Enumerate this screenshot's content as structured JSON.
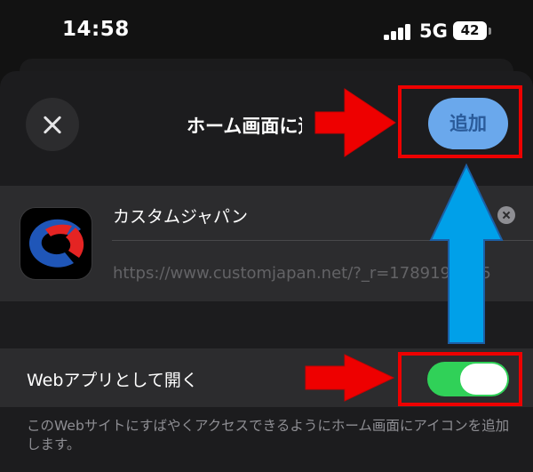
{
  "status_bar": {
    "time": "14:58",
    "network": "5G",
    "battery": "42",
    "signal_icon": "cellular-signal-icon",
    "battery_icon": "battery-icon"
  },
  "sheet": {
    "title": "ホーム画面に追加",
    "close_icon": "close-x-icon",
    "add_label": "追加"
  },
  "app": {
    "name": "カスタムジャパン",
    "url": "https://www.customjapan.net/?_r=178919_0G5",
    "icon": "custom-japan-logo",
    "clear_icon": "clear-circle-icon"
  },
  "web_app": {
    "label": "Webアプリとして開く",
    "toggle_on": true
  },
  "footer": {
    "text": "このWebサイトにすばやくアクセスできるようにホーム画面にアイコンを追加します。"
  },
  "colors": {
    "accent_button": "#6aa8ec",
    "toggle_on": "#30d158",
    "annotation_red": "#ee0000",
    "annotation_blue": "#00a0e9"
  }
}
